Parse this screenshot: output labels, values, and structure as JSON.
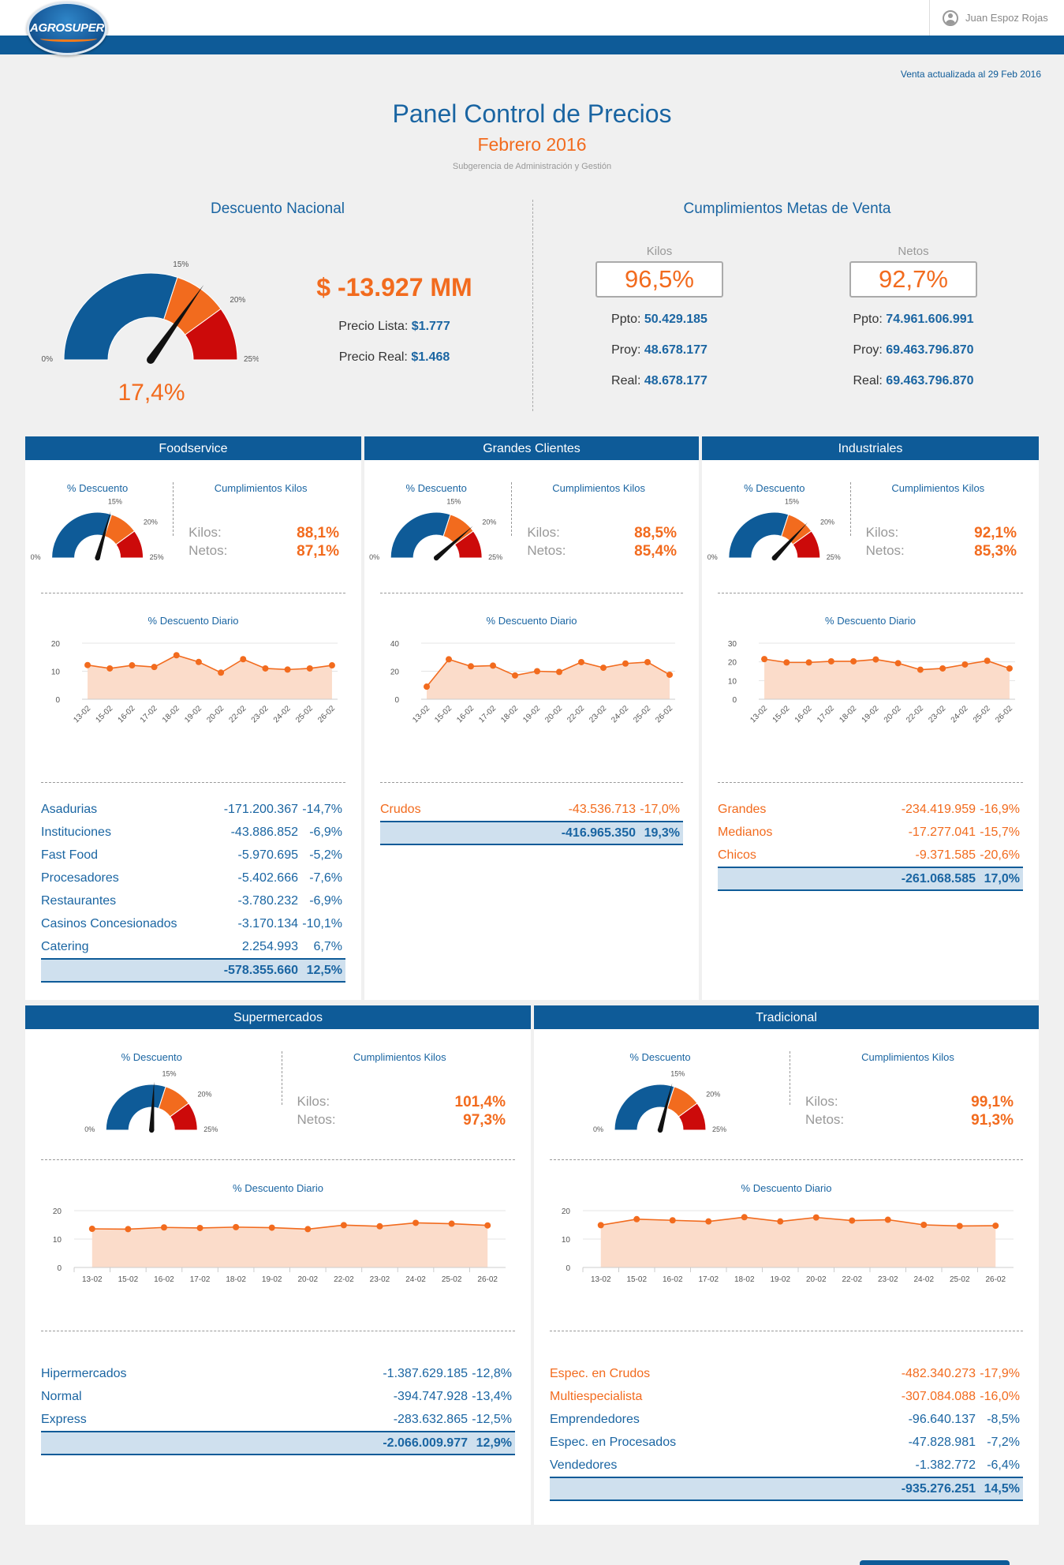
{
  "header": {
    "logo_text": "AGROSUPER",
    "user_name": "Juan Espoz Rojas"
  },
  "update_note": "Venta actualizada al 29 Feb 2016",
  "page": {
    "title": "Panel Control de Precios",
    "subtitle": "Febrero 2016",
    "department": "Subgerencia de Administración y Gestión"
  },
  "national": {
    "title": "Descuento Nacional",
    "gauge": {
      "value": 17.4,
      "value_text": "17,4%",
      "labels": [
        "0%",
        "15%",
        "20%",
        "25%"
      ]
    },
    "amount": "$ -13.927 MM",
    "precio_lista_label": "Precio Lista:",
    "precio_lista": "$1.777",
    "precio_real_label": "Precio Real:",
    "precio_real": "$1.468"
  },
  "goals": {
    "title": "Cumplimientos Metas de Venta",
    "kilos": {
      "label": "Kilos",
      "value": "96,5%",
      "ppto_label": "Ppto:",
      "ppto": "50.429.185",
      "proy_label": "Proy:",
      "proy": "48.678.177",
      "real_label": "Real:",
      "real": "48.678.177"
    },
    "netos": {
      "label": "Netos",
      "value": "92,7%",
      "ppto_label": "Ppto:",
      "ppto": "74.961.606.991",
      "proy_label": "Proy:",
      "proy": "69.463.796.870",
      "real_label": "Real:",
      "real": "69.463.796.870"
    }
  },
  "colors": {
    "primary": "#0e5b98",
    "accent": "#f26b1e",
    "danger": "#cc0a0a",
    "area": "#fbdcca"
  },
  "panels": [
    {
      "name": "Foodservice",
      "desc_title": "% Descuento",
      "cumpl_title": "Cumplimientos Kilos",
      "gauge_value": 14.7,
      "gauge_labels": [
        "0%",
        "15%",
        "20%",
        "25%"
      ],
      "kilos_label": "Kilos:",
      "kilos": "88,1%",
      "netos_label": "Netos:",
      "netos": "87,1%",
      "chart_title": "% Descuento Diario",
      "rows": [
        [
          "Asadurias",
          "-171.200.367",
          "-14,7%"
        ],
        [
          "Instituciones",
          "-43.886.852",
          "-6,9%"
        ],
        [
          "Fast Food",
          "-5.970.695",
          "-5,2%"
        ],
        [
          "Procesadores",
          "-5.402.666",
          "-7,6%"
        ],
        [
          "Restaurantes",
          "-3.780.232",
          "-6,9%"
        ],
        [
          "Casinos Concesionados",
          "-3.170.134",
          "-10,1%"
        ],
        [
          "Catering",
          "2.254.993",
          "6,7%"
        ]
      ],
      "row_color": "blue",
      "total": [
        "",
        "-578.355.660",
        "12,5%"
      ]
    },
    {
      "name": "Grandes Clientes",
      "desc_title": "% Descuento",
      "cumpl_title": "Cumplimientos Kilos",
      "gauge_value": 19.3,
      "gauge_labels": [
        "0%",
        "15%",
        "20%",
        "25%"
      ],
      "kilos_label": "Kilos:",
      "kilos": "88,5%",
      "netos_label": "Netos:",
      "netos": "85,4%",
      "chart_title": "% Descuento Diario",
      "rows": [
        [
          "Crudos",
          "-43.536.713",
          "-17,0%"
        ]
      ],
      "row_color": "orange",
      "total": [
        "",
        "-416.965.350",
        "19,3%"
      ]
    },
    {
      "name": "Industriales",
      "desc_title": "% Descuento",
      "cumpl_title": "Cumplimientos Kilos",
      "gauge_value": 18.5,
      "gauge_labels": [
        "0%",
        "15%",
        "20%",
        "25%"
      ],
      "kilos_label": "Kilos:",
      "kilos": "92,1%",
      "netos_label": "Netos:",
      "netos": "85,3%",
      "chart_title": "% Descuento Diario",
      "rows": [
        [
          "Grandes",
          "-234.419.959",
          "-16,9%"
        ],
        [
          "Medianos",
          "-17.277.041",
          "-15,7%"
        ],
        [
          "Chicos",
          "-9.371.585",
          "-20,6%"
        ]
      ],
      "row_color": "orange",
      "total": [
        "",
        "-261.068.585",
        "17,0%"
      ]
    },
    {
      "name": "Supermercados",
      "desc_title": "% Descuento",
      "cumpl_title": "Cumplimientos Kilos",
      "gauge_value": 12.9,
      "gauge_labels": [
        "0%",
        "15%",
        "20%",
        "25%"
      ],
      "kilos_label": "Kilos:",
      "kilos": "101,4%",
      "netos_label": "Netos:",
      "netos": "97,3%",
      "chart_title": "% Descuento Diario",
      "rows": [
        [
          "Hipermercados",
          "-1.387.629.185",
          "-12,8%"
        ],
        [
          "Normal",
          "-394.747.928",
          "-13,4%"
        ],
        [
          "Express",
          "-283.632.865",
          "-12,5%"
        ]
      ],
      "row_color": "blue",
      "total": [
        "",
        "-2.066.009.977",
        "12,9%"
      ]
    },
    {
      "name": "Tradicional",
      "desc_title": "% Descuento",
      "cumpl_title": "Cumplimientos Kilos",
      "gauge_value": 14.5,
      "gauge_labels": [
        "0%",
        "15%",
        "20%",
        "25%"
      ],
      "kilos_label": "Kilos:",
      "kilos": "99,1%",
      "netos_label": "Netos:",
      "netos": "91,3%",
      "chart_title": "% Descuento Diario",
      "rows": [
        [
          "Espec. en Crudos",
          "-482.340.273",
          "-17,9%"
        ],
        [
          "Multiespecialista",
          "-307.084.088",
          "-16,0%"
        ],
        [
          "Emprendedores",
          "-96.640.137",
          "-8,5%"
        ],
        [
          "Espec. en Procesados",
          "-47.828.981",
          "-7,2%"
        ],
        [
          "Vendedores",
          "-1.382.772",
          "-6,4%"
        ]
      ],
      "row_color": "mixed",
      "total": [
        "",
        "-935.276.251",
        "14,5%"
      ]
    }
  ],
  "chart_data": [
    {
      "type": "area",
      "title": "% Descuento Diario",
      "panel": "Foodservice",
      "x": [
        "13-02",
        "15-02",
        "16-02",
        "17-02",
        "18-02",
        "19-02",
        "20-02",
        "22-02",
        "23-02",
        "24-02",
        "25-02",
        "26-02"
      ],
      "series": [
        {
          "values": [
            12.2,
            11.0,
            12.1,
            11.5,
            15.7,
            13.3,
            9.5,
            14.3,
            11.0,
            10.6,
            11.0,
            12.1
          ]
        }
      ],
      "yticks": [
        0,
        10,
        20
      ],
      "ylim": [
        0,
        20
      ],
      "label_rotation": "diagonal"
    },
    {
      "type": "area",
      "title": "% Descuento Diario",
      "panel": "Grandes Clientes",
      "x": [
        "13-02",
        "15-02",
        "16-02",
        "17-02",
        "18-02",
        "19-02",
        "20-02",
        "22-02",
        "23-02",
        "24-02",
        "25-02",
        "26-02"
      ],
      "series": [
        {
          "values": [
            9.0,
            28.5,
            23.5,
            24.0,
            17.0,
            20.0,
            19.5,
            26.5,
            22.5,
            25.5,
            26.5,
            17.5
          ]
        }
      ],
      "yticks": [
        0,
        20,
        40
      ],
      "ylim": [
        0,
        40
      ],
      "label_rotation": "diagonal"
    },
    {
      "type": "area",
      "title": "% Descuento Diario",
      "panel": "Industriales",
      "x": [
        "13-02",
        "15-02",
        "16-02",
        "17-02",
        "18-02",
        "19-02",
        "20-02",
        "22-02",
        "23-02",
        "24-02",
        "25-02",
        "26-02"
      ],
      "series": [
        {
          "values": [
            21.5,
            19.7,
            19.7,
            20.3,
            20.3,
            21.3,
            19.3,
            15.8,
            16.5,
            18.6,
            20.6,
            16.5
          ]
        }
      ],
      "yticks": [
        0,
        10,
        20,
        30
      ],
      "ylim": [
        0,
        30
      ],
      "label_rotation": "diagonal"
    },
    {
      "type": "area",
      "title": "% Descuento Diario",
      "panel": "Supermercados",
      "x": [
        "13-02",
        "15-02",
        "16-02",
        "17-02",
        "18-02",
        "19-02",
        "20-02",
        "22-02",
        "23-02",
        "24-02",
        "25-02",
        "26-02"
      ],
      "series": [
        {
          "values": [
            13.6,
            13.5,
            14.1,
            13.9,
            14.2,
            14.0,
            13.5,
            14.9,
            14.5,
            15.7,
            15.4,
            14.8
          ]
        }
      ],
      "yticks": [
        0,
        10,
        20
      ],
      "ylim": [
        0,
        20
      ],
      "label_rotation": "horizontal"
    },
    {
      "type": "area",
      "title": "% Descuento Diario",
      "panel": "Tradicional",
      "x": [
        "13-02",
        "15-02",
        "16-02",
        "17-02",
        "18-02",
        "19-02",
        "20-02",
        "22-02",
        "23-02",
        "24-02",
        "25-02",
        "26-02"
      ],
      "series": [
        {
          "values": [
            14.9,
            17.0,
            16.6,
            16.2,
            17.7,
            16.2,
            17.6,
            16.5,
            16.8,
            15.0,
            14.6,
            14.7
          ]
        }
      ],
      "yticks": [
        0,
        10,
        20
      ],
      "ylim": [
        0,
        20
      ],
      "label_rotation": "horizontal"
    }
  ]
}
